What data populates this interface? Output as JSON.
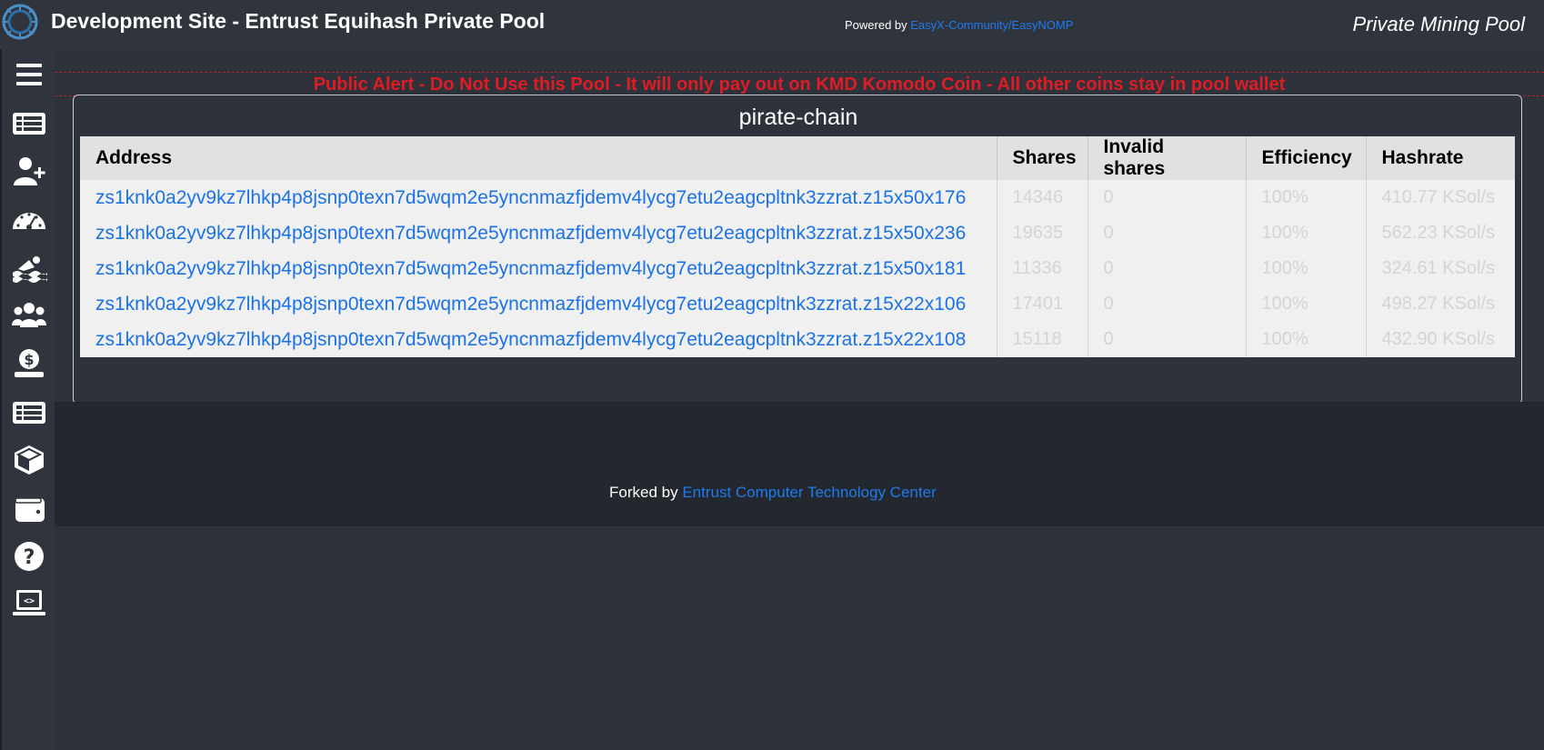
{
  "header": {
    "title": "Development Site - Entrust Equihash Private Pool",
    "powered_prefix": "Powered by ",
    "powered_link": "EasyX-Community/EasyNOMP",
    "brand": "Private Mining Pool"
  },
  "sidebar": {
    "items": [
      {
        "icon": "menu-icon"
      },
      {
        "icon": "list-icon"
      },
      {
        "icon": "add-user-icon"
      },
      {
        "icon": "speedometer-icon"
      },
      {
        "icon": "pool-swimmer-icon"
      },
      {
        "icon": "users-icon"
      },
      {
        "icon": "payout-icon"
      },
      {
        "icon": "blocks-list-icon"
      },
      {
        "icon": "cube-icon"
      },
      {
        "icon": "wallet-icon"
      },
      {
        "icon": "help-icon"
      },
      {
        "icon": "api-laptop-icon"
      }
    ]
  },
  "alert": {
    "text": "Public Alert - Do Not Use this Pool - It will only pay out on KMD Komodo Coin - All other coins stay in pool wallet"
  },
  "panel": {
    "title": "pirate-chain",
    "columns": [
      "Address",
      "Shares",
      "Invalid shares",
      "Efficiency",
      "Hashrate"
    ],
    "rows": [
      {
        "address": "zs1knk0a2yv9kz7lhkp4p8jsnp0texn7d5wqm2e5yncnmazfjdemv4lycg7etu2eagcpltnk3zzrat.z15x50x176",
        "shares": "14346",
        "invalid": "0",
        "efficiency": "100%",
        "hashrate": "410.77 KSol/s"
      },
      {
        "address": "zs1knk0a2yv9kz7lhkp4p8jsnp0texn7d5wqm2e5yncnmazfjdemv4lycg7etu2eagcpltnk3zzrat.z15x50x236",
        "shares": "19635",
        "invalid": "0",
        "efficiency": "100%",
        "hashrate": "562.23 KSol/s"
      },
      {
        "address": "zs1knk0a2yv9kz7lhkp4p8jsnp0texn7d5wqm2e5yncnmazfjdemv4lycg7etu2eagcpltnk3zzrat.z15x50x181",
        "shares": "11336",
        "invalid": "0",
        "efficiency": "100%",
        "hashrate": "324.61 KSol/s"
      },
      {
        "address": "zs1knk0a2yv9kz7lhkp4p8jsnp0texn7d5wqm2e5yncnmazfjdemv4lycg7etu2eagcpltnk3zzrat.z15x22x106",
        "shares": "17401",
        "invalid": "0",
        "efficiency": "100%",
        "hashrate": "498.27 KSol/s"
      },
      {
        "address": "zs1knk0a2yv9kz7lhkp4p8jsnp0texn7d5wqm2e5yncnmazfjdemv4lycg7etu2eagcpltnk3zzrat.z15x22x108",
        "shares": "15118",
        "invalid": "0",
        "efficiency": "100%",
        "hashrate": "432.90 KSol/s"
      }
    ]
  },
  "footer": {
    "prefix": "Forked by ",
    "link": "Entrust Computer Technology Center"
  },
  "colors": {
    "background": "#2d323b",
    "footer": "#23272e",
    "link": "#1a72e6",
    "alert": "#e01b24"
  }
}
